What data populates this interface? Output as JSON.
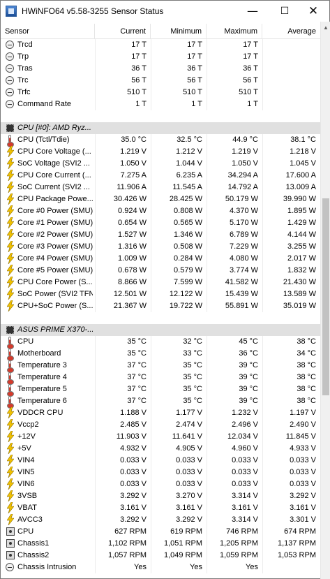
{
  "window": {
    "title": "HWiNFO64 v5.58-3255 Sensor Status",
    "min_glyph": "—",
    "max_glyph": "☐",
    "close_glyph": "✕"
  },
  "columns": {
    "sensor": "Sensor",
    "current": "Current",
    "minimum": "Minimum",
    "maximum": "Maximum",
    "average": "Average"
  },
  "rows": [
    {
      "type": "sensor",
      "icon": "clock-icon",
      "name": "Trcd",
      "cur": "17 T",
      "min": "17 T",
      "max": "17 T",
      "avg": ""
    },
    {
      "type": "sensor",
      "icon": "clock-icon",
      "name": "Trp",
      "cur": "17 T",
      "min": "17 T",
      "max": "17 T",
      "avg": ""
    },
    {
      "type": "sensor",
      "icon": "clock-icon",
      "name": "Tras",
      "cur": "36 T",
      "min": "36 T",
      "max": "36 T",
      "avg": ""
    },
    {
      "type": "sensor",
      "icon": "clock-icon",
      "name": "Trc",
      "cur": "56 T",
      "min": "56 T",
      "max": "56 T",
      "avg": ""
    },
    {
      "type": "sensor",
      "icon": "clock-icon",
      "name": "Trfc",
      "cur": "510 T",
      "min": "510 T",
      "max": "510 T",
      "avg": ""
    },
    {
      "type": "sensor",
      "icon": "clock-icon",
      "name": "Command Rate",
      "cur": "1 T",
      "min": "1 T",
      "max": "1 T",
      "avg": ""
    },
    {
      "type": "spacer"
    },
    {
      "type": "group",
      "icon": "chip-icon",
      "name": "CPU [#0]: AMD Ryz..."
    },
    {
      "type": "sensor",
      "icon": "thermometer-icon",
      "name": "CPU (Tctl/Tdie)",
      "cur": "35.0 °C",
      "min": "32.5 °C",
      "max": "44.9 °C",
      "avg": "38.1 °C"
    },
    {
      "type": "sensor",
      "icon": "lightning-icon",
      "name": "CPU Core Voltage (...",
      "cur": "1.219 V",
      "min": "1.212 V",
      "max": "1.219 V",
      "avg": "1.218 V"
    },
    {
      "type": "sensor",
      "icon": "lightning-icon",
      "name": "SoC Voltage (SVI2 ...",
      "cur": "1.050 V",
      "min": "1.044 V",
      "max": "1.050 V",
      "avg": "1.045 V"
    },
    {
      "type": "sensor",
      "icon": "lightning-icon",
      "name": "CPU Core Current (...",
      "cur": "7.275 A",
      "min": "6.235 A",
      "max": "34.294 A",
      "avg": "17.600 A"
    },
    {
      "type": "sensor",
      "icon": "lightning-icon",
      "name": "SoC Current (SVI2 ...",
      "cur": "11.906 A",
      "min": "11.545 A",
      "max": "14.792 A",
      "avg": "13.009 A"
    },
    {
      "type": "sensor",
      "icon": "lightning-icon",
      "name": "CPU Package Powe...",
      "cur": "30.426 W",
      "min": "28.425 W",
      "max": "50.179 W",
      "avg": "39.990 W"
    },
    {
      "type": "sensor",
      "icon": "lightning-icon",
      "name": "Core #0 Power (SMU)",
      "cur": "0.924 W",
      "min": "0.808 W",
      "max": "4.370 W",
      "avg": "1.895 W"
    },
    {
      "type": "sensor",
      "icon": "lightning-icon",
      "name": "Core #1 Power (SMU)",
      "cur": "0.654 W",
      "min": "0.565 W",
      "max": "5.170 W",
      "avg": "1.429 W"
    },
    {
      "type": "sensor",
      "icon": "lightning-icon",
      "name": "Core #2 Power (SMU)",
      "cur": "1.527 W",
      "min": "1.346 W",
      "max": "6.789 W",
      "avg": "4.144 W"
    },
    {
      "type": "sensor",
      "icon": "lightning-icon",
      "name": "Core #3 Power (SMU)",
      "cur": "1.316 W",
      "min": "0.508 W",
      "max": "7.229 W",
      "avg": "3.255 W"
    },
    {
      "type": "sensor",
      "icon": "lightning-icon",
      "name": "Core #4 Power (SMU)",
      "cur": "1.009 W",
      "min": "0.284 W",
      "max": "4.080 W",
      "avg": "2.017 W"
    },
    {
      "type": "sensor",
      "icon": "lightning-icon",
      "name": "Core #5 Power (SMU)",
      "cur": "0.678 W",
      "min": "0.579 W",
      "max": "3.774 W",
      "avg": "1.832 W"
    },
    {
      "type": "sensor",
      "icon": "lightning-icon",
      "name": "CPU Core Power (S...",
      "cur": "8.866 W",
      "min": "7.599 W",
      "max": "41.582 W",
      "avg": "21.430 W"
    },
    {
      "type": "sensor",
      "icon": "lightning-icon",
      "name": "SoC Power (SVI2 TFN)",
      "cur": "12.501 W",
      "min": "12.122 W",
      "max": "15.439 W",
      "avg": "13.589 W"
    },
    {
      "type": "sensor",
      "icon": "lightning-icon",
      "name": "CPU+SoC Power (S...",
      "cur": "21.367 W",
      "min": "19.722 W",
      "max": "55.891 W",
      "avg": "35.019 W"
    },
    {
      "type": "spacer"
    },
    {
      "type": "group",
      "icon": "chip-icon",
      "name": "ASUS PRIME X370-..."
    },
    {
      "type": "sensor",
      "icon": "thermometer-icon",
      "name": "CPU",
      "cur": "35 °C",
      "min": "32 °C",
      "max": "45 °C",
      "avg": "38 °C"
    },
    {
      "type": "sensor",
      "icon": "thermometer-icon",
      "name": "Motherboard",
      "cur": "35 °C",
      "min": "33 °C",
      "max": "36 °C",
      "avg": "34 °C"
    },
    {
      "type": "sensor",
      "icon": "thermometer-icon",
      "name": "Temperature 3",
      "cur": "37 °C",
      "min": "35 °C",
      "max": "39 °C",
      "avg": "38 °C"
    },
    {
      "type": "sensor",
      "icon": "thermometer-icon",
      "name": "Temperature 4",
      "cur": "37 °C",
      "min": "35 °C",
      "max": "39 °C",
      "avg": "38 °C"
    },
    {
      "type": "sensor",
      "icon": "thermometer-icon",
      "name": "Temperature 5",
      "cur": "37 °C",
      "min": "35 °C",
      "max": "39 °C",
      "avg": "38 °C"
    },
    {
      "type": "sensor",
      "icon": "thermometer-icon",
      "name": "Temperature 6",
      "cur": "37 °C",
      "min": "35 °C",
      "max": "39 °C",
      "avg": "38 °C"
    },
    {
      "type": "sensor",
      "icon": "lightning-icon",
      "name": "VDDCR CPU",
      "cur": "1.188 V",
      "min": "1.177 V",
      "max": "1.232 V",
      "avg": "1.197 V"
    },
    {
      "type": "sensor",
      "icon": "lightning-icon",
      "name": "Vccp2",
      "cur": "2.485 V",
      "min": "2.474 V",
      "max": "2.496 V",
      "avg": "2.490 V"
    },
    {
      "type": "sensor",
      "icon": "lightning-icon",
      "name": "+12V",
      "cur": "11.903 V",
      "min": "11.641 V",
      "max": "12.034 V",
      "avg": "11.845 V"
    },
    {
      "type": "sensor",
      "icon": "lightning-icon",
      "name": "+5V",
      "cur": "4.932 V",
      "min": "4.905 V",
      "max": "4.960 V",
      "avg": "4.933 V"
    },
    {
      "type": "sensor",
      "icon": "lightning-icon",
      "name": "VIN4",
      "cur": "0.033 V",
      "min": "0.033 V",
      "max": "0.033 V",
      "avg": "0.033 V"
    },
    {
      "type": "sensor",
      "icon": "lightning-icon",
      "name": "VIN5",
      "cur": "0.033 V",
      "min": "0.033 V",
      "max": "0.033 V",
      "avg": "0.033 V"
    },
    {
      "type": "sensor",
      "icon": "lightning-icon",
      "name": "VIN6",
      "cur": "0.033 V",
      "min": "0.033 V",
      "max": "0.033 V",
      "avg": "0.033 V"
    },
    {
      "type": "sensor",
      "icon": "lightning-icon",
      "name": "3VSB",
      "cur": "3.292 V",
      "min": "3.270 V",
      "max": "3.314 V",
      "avg": "3.292 V"
    },
    {
      "type": "sensor",
      "icon": "lightning-icon",
      "name": "VBAT",
      "cur": "3.161 V",
      "min": "3.161 V",
      "max": "3.161 V",
      "avg": "3.161 V"
    },
    {
      "type": "sensor",
      "icon": "lightning-icon",
      "name": "AVCC3",
      "cur": "3.292 V",
      "min": "3.292 V",
      "max": "3.314 V",
      "avg": "3.301 V"
    },
    {
      "type": "sensor",
      "icon": "fan-icon",
      "name": "CPU",
      "cur": "627 RPM",
      "min": "619 RPM",
      "max": "746 RPM",
      "avg": "674 RPM"
    },
    {
      "type": "sensor",
      "icon": "fan-icon",
      "name": "Chassis1",
      "cur": "1,102 RPM",
      "min": "1,051 RPM",
      "max": "1,205 RPM",
      "avg": "1,137 RPM"
    },
    {
      "type": "sensor",
      "icon": "fan-icon",
      "name": "Chassis2",
      "cur": "1,057 RPM",
      "min": "1,049 RPM",
      "max": "1,059 RPM",
      "avg": "1,053 RPM"
    },
    {
      "type": "sensor",
      "icon": "clock-icon",
      "name": "Chassis Intrusion",
      "cur": "Yes",
      "min": "Yes",
      "max": "Yes",
      "avg": ""
    }
  ]
}
